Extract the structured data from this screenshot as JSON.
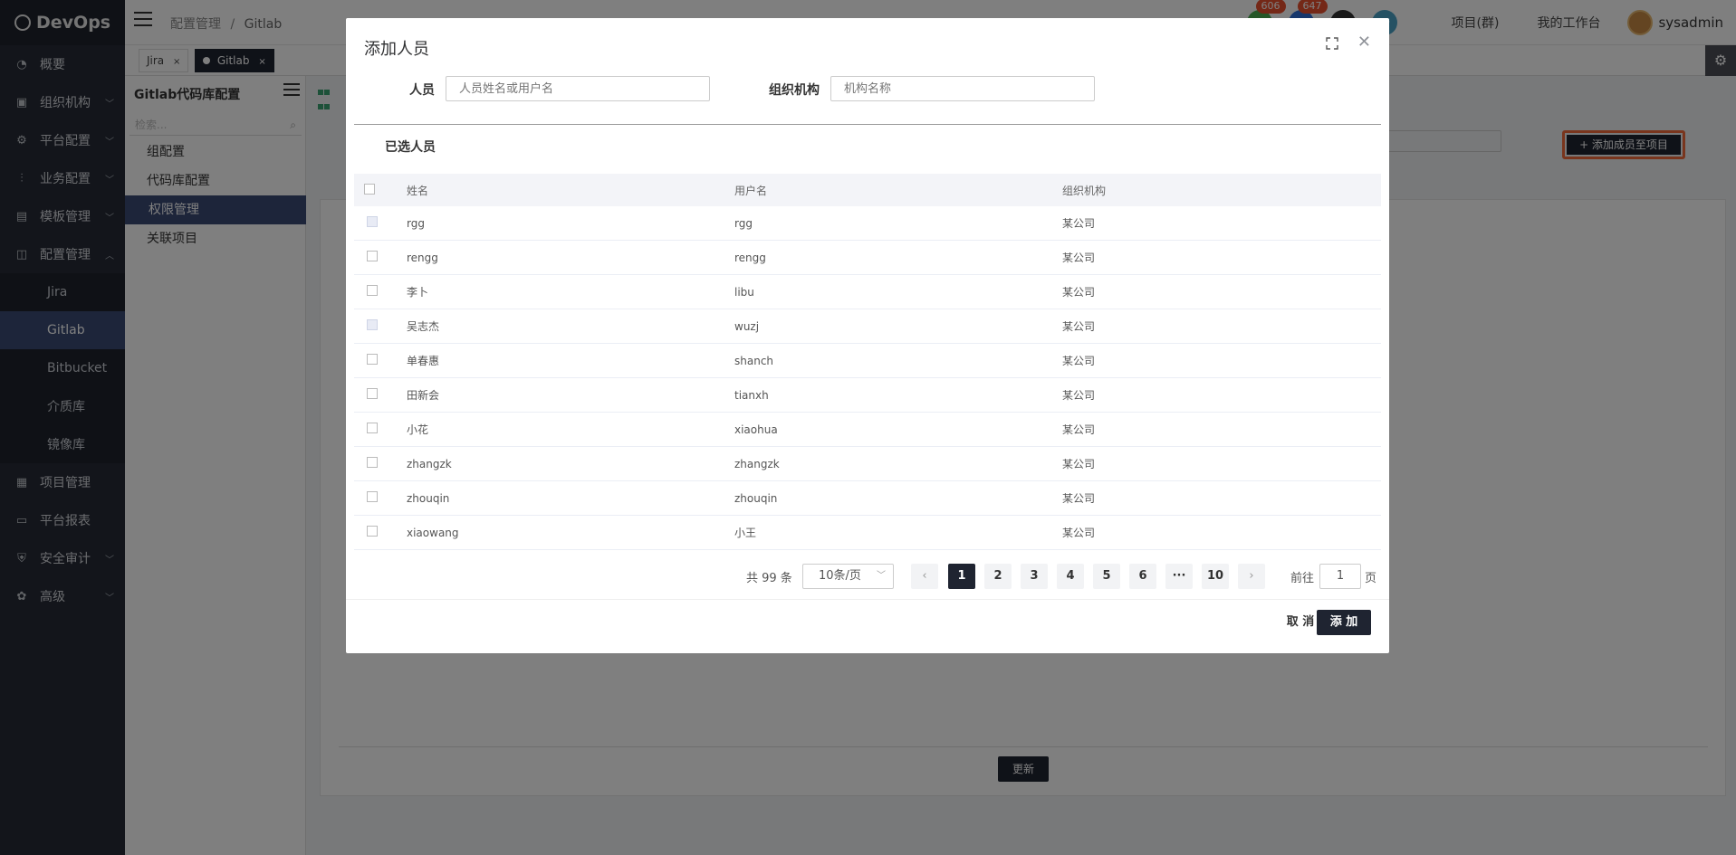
{
  "app": {
    "logo": "DevOps"
  },
  "sidebar": {
    "items": [
      {
        "label": "概要",
        "icon": "dashboard-icon",
        "chevron": ""
      },
      {
        "label": "组织机构",
        "icon": "lock-icon",
        "chevron": "﹀"
      },
      {
        "label": "平台配置",
        "icon": "gear-icon",
        "chevron": "﹀"
      },
      {
        "label": "业务配置",
        "icon": "sliders-icon",
        "chevron": "﹀"
      },
      {
        "label": "模板管理",
        "icon": "template-icon",
        "chevron": "﹀"
      },
      {
        "label": "配置管理",
        "icon": "database-icon",
        "chevron": "︿"
      }
    ],
    "sub_items": [
      {
        "label": "Jira"
      },
      {
        "label": "Gitlab"
      },
      {
        "label": "Bitbucket"
      },
      {
        "label": "介质库"
      },
      {
        "label": "镜像库"
      }
    ],
    "items_after": [
      {
        "label": "项目管理",
        "icon": "apps-icon",
        "chevron": ""
      },
      {
        "label": "平台报表",
        "icon": "monitor-icon",
        "chevron": ""
      },
      {
        "label": "安全审计",
        "icon": "shield-icon",
        "chevron": "﹀"
      },
      {
        "label": "高级",
        "icon": "advanced-icon",
        "chevron": "﹀"
      }
    ]
  },
  "header": {
    "breadcrumb": [
      "配置管理",
      "/",
      "Gitlab"
    ],
    "badge1": "606",
    "badge2": "647",
    "project_link": "项目(群)",
    "workbench_link": "我的工作台",
    "username": "sysadmin"
  },
  "tabs": [
    {
      "label": "Jira",
      "close": "×"
    },
    {
      "label": "Gitlab",
      "close": "×"
    }
  ],
  "subpanel": {
    "title": "Gitlab代码库配置",
    "search_placeholder": "检索...",
    "items": [
      "组配置",
      "代码库配置",
      "权限管理",
      "关联项目"
    ]
  },
  "main": {
    "add_member_button": "+ 添加成员至项目",
    "update_button": "更新"
  },
  "modal": {
    "title": "添加人员",
    "person_label": "人员",
    "person_placeholder": "人员姓名或用户名",
    "org_label": "组织机构",
    "org_placeholder": "机构名称",
    "selected_label": "已选人员",
    "columns": [
      "姓名",
      "用户名",
      "组织机构"
    ],
    "rows": [
      {
        "name": "rgg",
        "username": "rgg",
        "org": "某公司",
        "checked_style": "dim"
      },
      {
        "name": "rengg",
        "username": "rengg",
        "org": "某公司",
        "checked_style": ""
      },
      {
        "name": "李卜",
        "username": "libu",
        "org": "某公司",
        "checked_style": ""
      },
      {
        "name": "吴志杰",
        "username": "wuzj",
        "org": "某公司",
        "checked_style": "dim"
      },
      {
        "name": "单春惠",
        "username": "shanch",
        "org": "某公司",
        "checked_style": ""
      },
      {
        "name": "田新会",
        "username": "tianxh",
        "org": "某公司",
        "checked_style": ""
      },
      {
        "name": "小花",
        "username": "xiaohua",
        "org": "某公司",
        "checked_style": ""
      },
      {
        "name": "zhangzk",
        "username": "zhangzk",
        "org": "某公司",
        "checked_style": ""
      },
      {
        "name": "zhouqin",
        "username": "zhouqin",
        "org": "某公司",
        "checked_style": ""
      },
      {
        "name": "xiaowang",
        "username": "小王",
        "org": "某公司",
        "checked_style": ""
      }
    ],
    "pagination": {
      "total": "共 99 条",
      "page_size": "10条/页",
      "prev": "‹",
      "pages": [
        "1",
        "2",
        "3",
        "4",
        "5",
        "6",
        "···",
        "10"
      ],
      "next": "›",
      "goto_label": "前往",
      "goto_value": "1",
      "goto_unit": "页"
    },
    "cancel": "取 消",
    "confirm": "添 加"
  },
  "colors": {
    "sidebar_bg": "#262b36",
    "active_item": "#3a4a75",
    "primary_dark": "#1f2431",
    "highlight_border": "#f26b3a",
    "badge": "#e8502f"
  }
}
